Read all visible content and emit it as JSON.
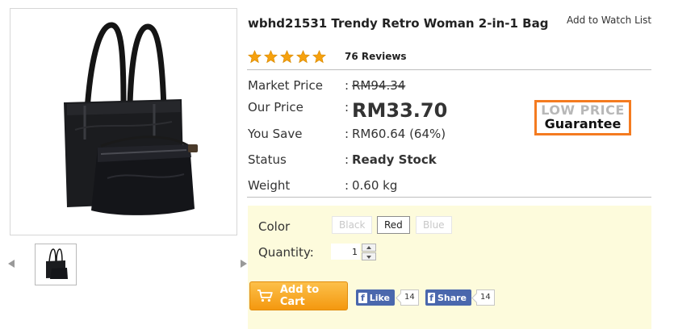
{
  "product": {
    "title": "wbhd21531 Trendy Retro Woman 2-in-1 Bag",
    "watch_list_label": "Add to Watch List",
    "rating_stars": 5,
    "reviews_label": "76 Reviews"
  },
  "pricing": {
    "market_price_label": "Market Price",
    "market_price_value": "RM94.34",
    "our_price_label": "Our Price",
    "our_price_value": "RM33.70",
    "you_save_label": "You Save",
    "you_save_value": "RM60.64 (64%)",
    "status_label": "Status",
    "status_value": "Ready Stock",
    "weight_label": "Weight",
    "weight_value": "0.60 kg",
    "colon": ":",
    "guarantee_top": "LOW PRICE",
    "guarantee_bottom": "Guarantee"
  },
  "options": {
    "color_label": "Color",
    "colors": [
      "Black",
      "Red",
      "Blue"
    ],
    "selected_color": "Red",
    "quantity_label": "Quantity:",
    "quantity_value": "1"
  },
  "actions": {
    "add_to_cart_label": "Add to Cart",
    "like_label": "Like",
    "like_count": "14",
    "share_label": "Share",
    "share_count": "14"
  },
  "icons": {
    "star": "star-icon",
    "cart": "cart-icon",
    "facebook": "facebook-icon",
    "prev": "arrow-left-icon",
    "next": "arrow-right-icon"
  },
  "colors": {
    "price_orange": "#ee6a17",
    "stock_green": "#3d9b17",
    "star_gold": "#f6a10e",
    "panel_bg": "#fdfbdc",
    "facebook_blue": "#4a67ad",
    "guarantee_orange": "#f47b20"
  }
}
